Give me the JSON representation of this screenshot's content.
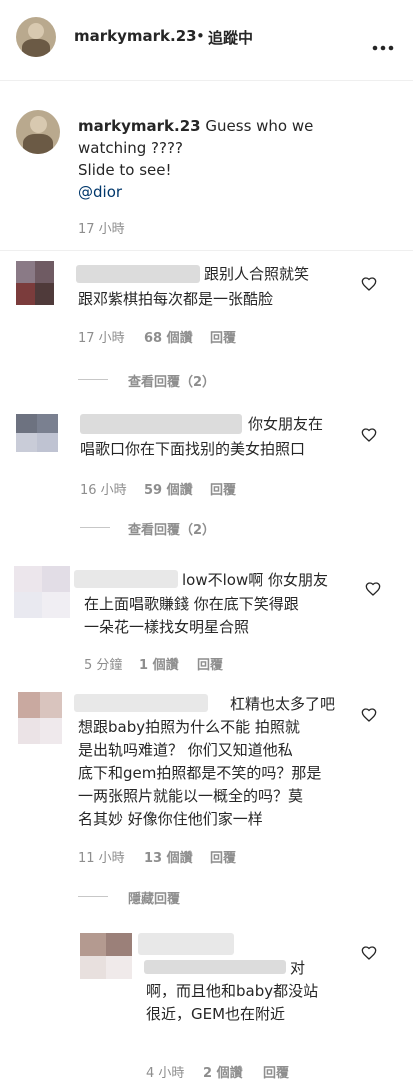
{
  "header": {
    "username": "markymark.23",
    "separator": "•",
    "follow_status": "追蹤中",
    "more_icon": "more-horizontal-icon"
  },
  "caption": {
    "username": "markymark.23",
    "line1": "Guess who we",
    "line2": "watching ????",
    "line3": "Slide to see!",
    "mention": "@dior",
    "time": "17 小時"
  },
  "comments": [
    {
      "text1": "跟别人合照就笑",
      "text2": "跟邓紫棋拍每次都是一张酷脸",
      "time": "17 小時",
      "likes": "68 個讚",
      "reply": "回覆",
      "view_replies": "查看回覆（2）"
    },
    {
      "text1": "你女朋友在",
      "text2": "唱歌口你在下面找别的美女拍照口",
      "time": "16 小時",
      "likes": "59 個讚",
      "reply": "回覆",
      "view_replies": "查看回覆（2）"
    },
    {
      "text1": "low不low啊 你女朋友",
      "text2": "在上面唱歌賺錢 你在底下笑得跟",
      "text3": "一朵花一樣找女明星合照",
      "time": "5 分鐘",
      "likes": "1 個讚",
      "reply": "回覆"
    },
    {
      "text1": "杠精也太多了吧",
      "text2": "想跟baby拍照为什么不能 拍照就",
      "text3": "是出轨吗难道？ 你们又知道他私",
      "text4": "底下和gem拍照都是不笑的吗？那是",
      "text5": "一两张照片就能以一概全的吗？莫",
      "text6": "名其妙 好像你住他们家一样",
      "time": "11 小時",
      "likes": "13 個讚",
      "reply": "回覆",
      "hide_replies": "隱藏回覆"
    }
  ],
  "reply": {
    "text1": "对",
    "text2": "啊，而且他和baby都没站",
    "text3": "很近，GEM也在附近",
    "time": "4 小時",
    "likes": "2 個讚",
    "reply": "回覆"
  },
  "colors": {
    "text": "#262626",
    "muted": "#8e8e8e",
    "link": "#00376b",
    "divider": "#efefef"
  }
}
